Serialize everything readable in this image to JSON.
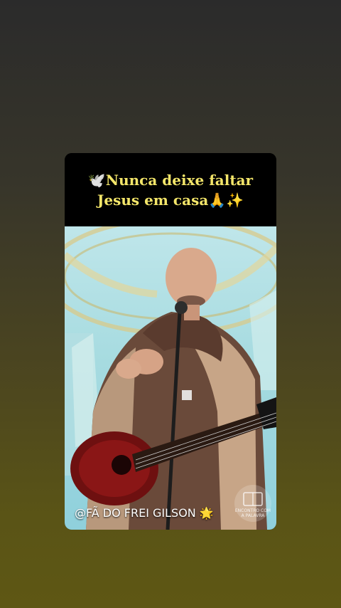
{
  "post": {
    "title_line_1": "🕊️Nunca deixe faltar",
    "title_line_2": "Jesus em casa🙏✨",
    "caption": "@FÃ DO FREI GILSON 🌟",
    "watermark_text": "ENCONTRO COM A PALAVRA"
  },
  "colors": {
    "title": "#f4e66a",
    "background_top": "#2b2b2b",
    "background_bottom": "#5e5714"
  }
}
